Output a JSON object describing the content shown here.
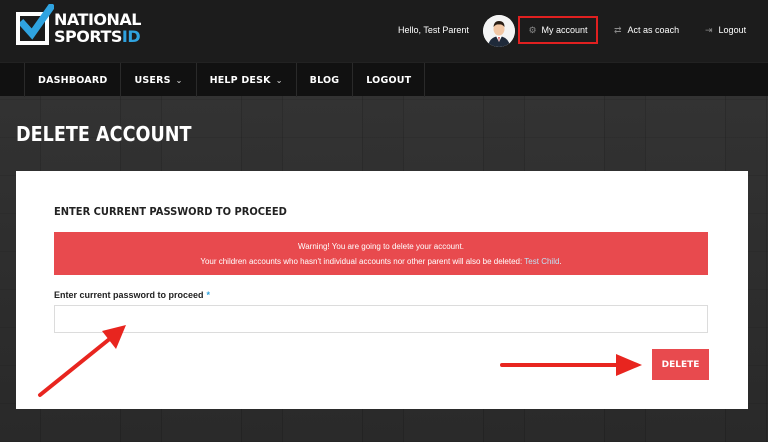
{
  "brand": {
    "line1": "NATIONAL",
    "line2_a": "SPORTS",
    "line2_b": "ID"
  },
  "topbar": {
    "greeting": "Hello, Test Parent",
    "my_account": "My account",
    "act_as_coach": "Act as coach",
    "logout": "Logout"
  },
  "nav": {
    "items": [
      {
        "label": "DASHBOARD"
      },
      {
        "label": "USERS"
      },
      {
        "label": "HELP DESK"
      },
      {
        "label": "BLOG"
      },
      {
        "label": "LOGOUT"
      }
    ]
  },
  "page": {
    "title": "DELETE ACCOUNT",
    "heading": "ENTER CURRENT PASSWORD TO PROCEED",
    "alert_line1": "Warning! You are going to delete your account.",
    "alert_line2": "Your children accounts who hasn't individual accounts nor other parent will also be deleted:",
    "alert_link": "Test Child",
    "alert_end": ".",
    "field_label": "Enter current password to proceed",
    "required_mark": "*",
    "password_value": "",
    "delete_label": "DELETE"
  },
  "colors": {
    "accent_red": "#e84a4e",
    "highlight_red": "#e02020",
    "brand_blue": "#2fa3e0"
  }
}
